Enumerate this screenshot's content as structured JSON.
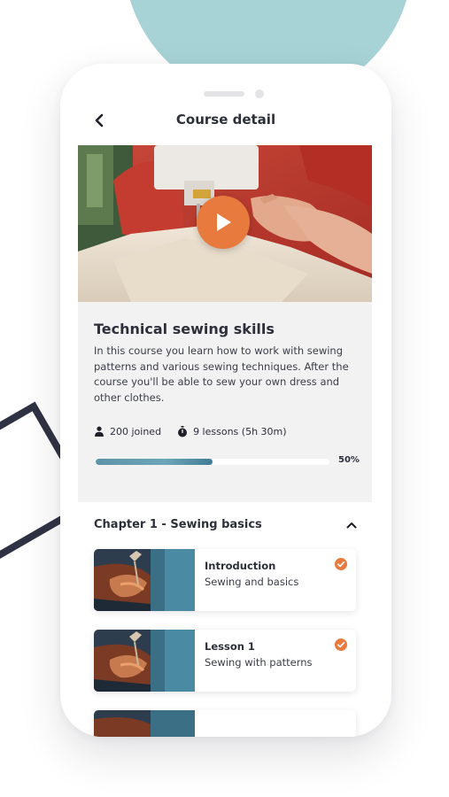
{
  "header": {
    "title": "Course detail",
    "back_icon": "chevron-left-icon"
  },
  "course": {
    "title": "Technical sewing skills",
    "description": "In this course you learn how to work with sewing patterns and various sewing techniques. After the course you'll be able to sew your own dress and other clothes.",
    "joined": "200 joined",
    "lessons": "9 lessons (5h 30m)",
    "progress_fraction": 0.5,
    "progress_label": "50%"
  },
  "chapter": {
    "title": "Chapter 1 - Sewing basics",
    "expanded": true,
    "lessons": [
      {
        "title": "Introduction",
        "subtitle": "Sewing and basics",
        "completed": true
      },
      {
        "title": "Lesson 1",
        "subtitle": "Sewing with patterns",
        "completed": true
      }
    ]
  },
  "colors": {
    "accent": "#e97a3e",
    "progress": "#5d93a8",
    "teal_shape": "#a7d3d6",
    "card_bg": "#f2f2f3",
    "text": "#2d2f3a"
  }
}
